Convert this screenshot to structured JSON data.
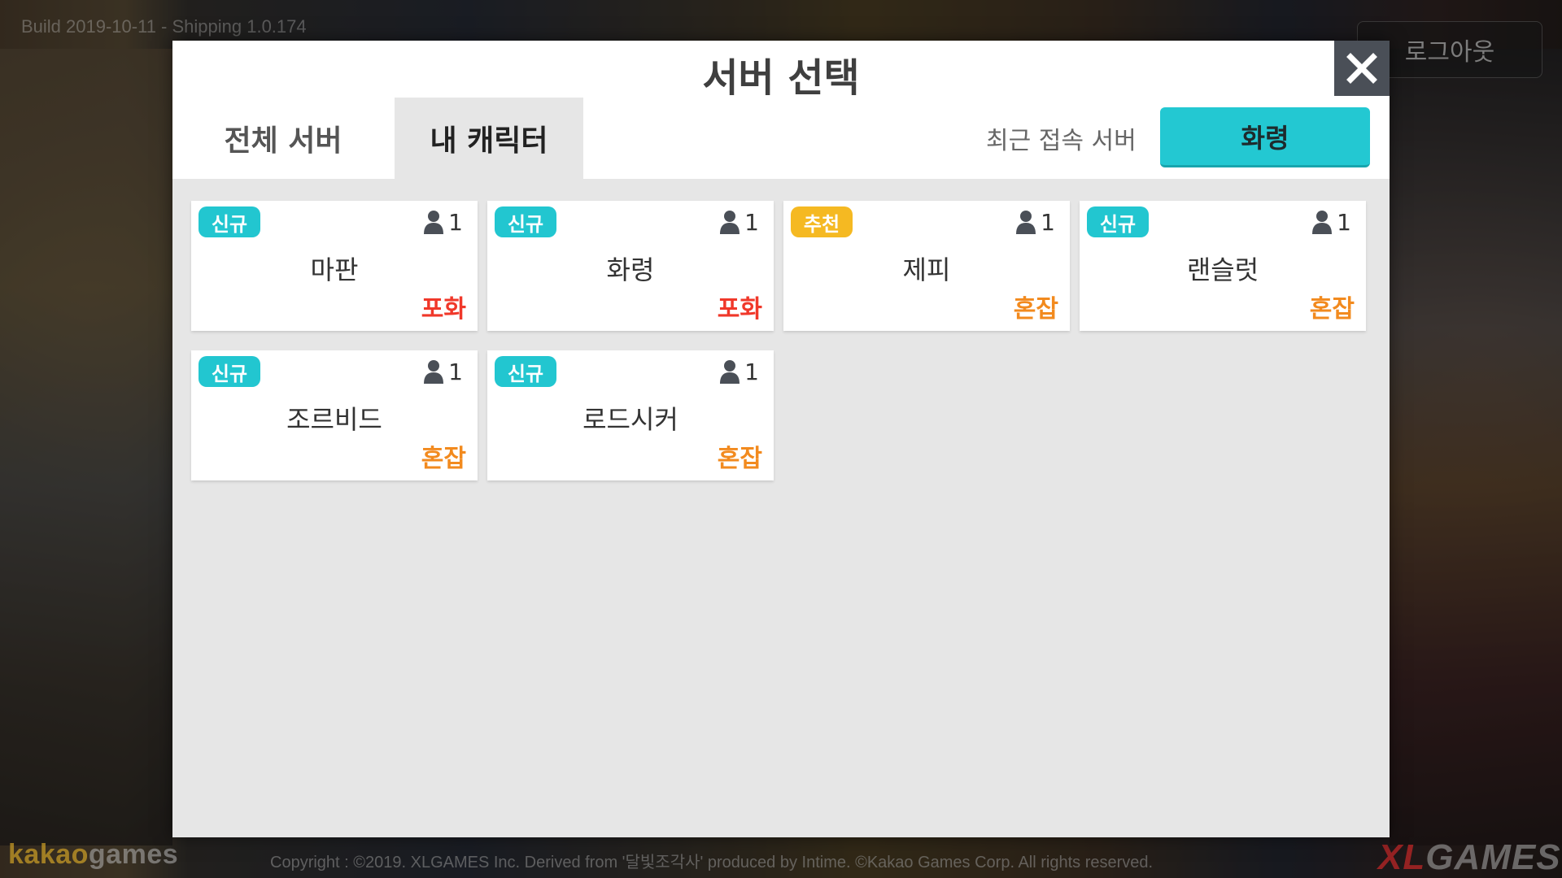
{
  "background": {
    "build_text": "Build 2019-10-11 - Shipping 1.0.174",
    "logout_label": "로그아웃",
    "footer_logo_left_a": "kakao",
    "footer_logo_left_b": "games",
    "footer_copyright": "Copyright : ©2019. XLGAMES Inc. Derived from '달빛조각사' produced by Intime. ©Kakao Games Corp. All rights reserved.",
    "footer_logo_right_a": "XL",
    "footer_logo_right_b": "GAMES"
  },
  "modal": {
    "title": "서버 선택",
    "close_icon": "close-icon",
    "tabs": [
      {
        "label": "전체 서버",
        "active": false
      },
      {
        "label": "내 캐릭터",
        "active": true
      }
    ],
    "recent_label": "최근 접속 서버",
    "recent_server": "화령"
  },
  "colors": {
    "accent_cyan": "#22c6d0",
    "badge_recommend": "#f5b922",
    "status_full": "#f0382a",
    "status_busy": "#f28a1e"
  },
  "servers": [
    {
      "badge": "신규",
      "badge_type": "new",
      "count": "1",
      "name": "마판",
      "status": "포화",
      "status_type": "full"
    },
    {
      "badge": "신규",
      "badge_type": "new",
      "count": "1",
      "name": "화령",
      "status": "포화",
      "status_type": "full"
    },
    {
      "badge": "추천",
      "badge_type": "rec",
      "count": "1",
      "name": "제피",
      "status": "혼잡",
      "status_type": "busy"
    },
    {
      "badge": "신규",
      "badge_type": "new",
      "count": "1",
      "name": "랜슬럿",
      "status": "혼잡",
      "status_type": "busy"
    },
    {
      "badge": "신규",
      "badge_type": "new",
      "count": "1",
      "name": "조르비드",
      "status": "혼잡",
      "status_type": "busy"
    },
    {
      "badge": "신규",
      "badge_type": "new",
      "count": "1",
      "name": "로드시커",
      "status": "혼잡",
      "status_type": "busy"
    }
  ]
}
